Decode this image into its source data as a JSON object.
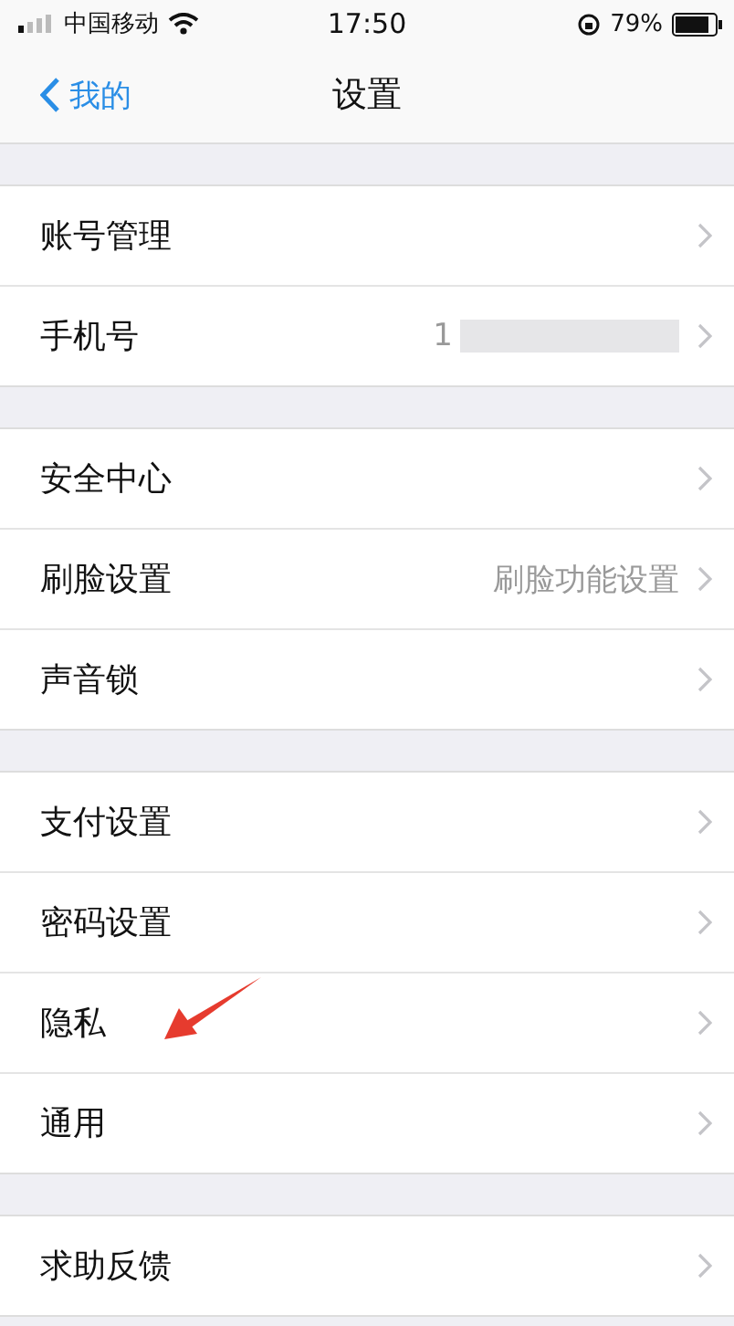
{
  "status_bar": {
    "carrier": "中国移动",
    "time": "17:50",
    "battery": "79%"
  },
  "nav": {
    "back": "我的",
    "title": "设置"
  },
  "groups": [
    {
      "rows": [
        {
          "label": "账号管理"
        },
        {
          "label": "手机号",
          "value": "1",
          "masked": true
        }
      ]
    },
    {
      "rows": [
        {
          "label": "安全中心"
        },
        {
          "label": "刷脸设置",
          "value": "刷脸功能设置"
        },
        {
          "label": "声音锁"
        }
      ]
    },
    {
      "rows": [
        {
          "label": "支付设置"
        },
        {
          "label": "密码设置"
        },
        {
          "label": "隐私",
          "pointed": true
        },
        {
          "label": "通用"
        }
      ]
    },
    {
      "rows": [
        {
          "label": "求助反馈"
        }
      ]
    }
  ]
}
